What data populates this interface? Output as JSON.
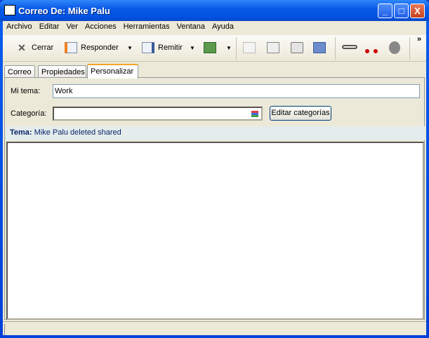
{
  "window": {
    "title": "Correo De:  Mike Palu",
    "minimize": "_",
    "maximize": "□",
    "close": "X"
  },
  "menu": [
    "Archivo",
    "Editar",
    "Ver",
    "Acciones",
    "Herramientas",
    "Ventana",
    "Ayuda"
  ],
  "toolbar": {
    "close": "Cerrar",
    "reply": "Responder",
    "forward": "Remitir",
    "more": "»"
  },
  "tabs": [
    "Correo",
    "Propiedades",
    "Personalizar"
  ],
  "form": {
    "subject_label": "Mi tema:",
    "subject_value": "Work",
    "category_label": "Categoría:",
    "category_value": "",
    "edit_categories": "Editar categorías"
  },
  "topic": {
    "label": "Tema:",
    "value": "Mike Palu deleted shared"
  }
}
